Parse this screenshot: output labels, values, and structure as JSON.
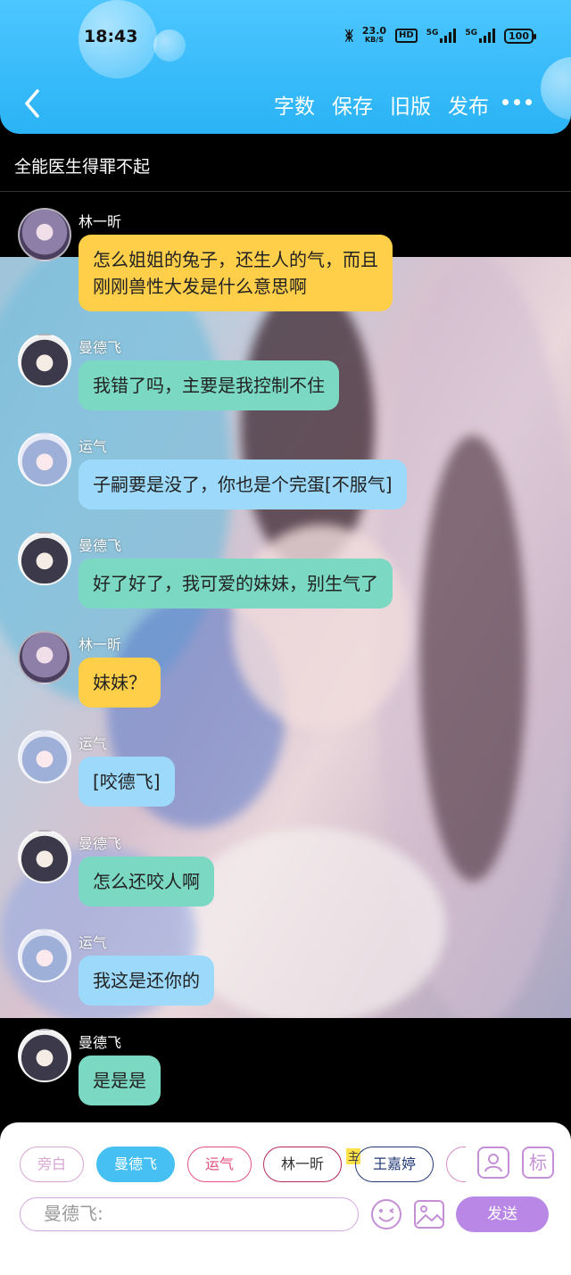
{
  "status_bar": {
    "time": "18:43",
    "speed_value": "23.0",
    "speed_unit": "KB/S",
    "hd": "HD",
    "network_1": "5G",
    "network_2": "5G",
    "battery": "100"
  },
  "header": {
    "back_icon": "chevron-left-icon",
    "actions": [
      "字数",
      "保存",
      "旧版",
      "发布"
    ],
    "more_icon": "more-dots-icon",
    "color": "#35b8f6"
  },
  "document": {
    "title": "全能医生得罪不起"
  },
  "messages": [
    {
      "speaker": "林一昕",
      "text_lines": [
        "怎么姐姐的兔子，还生人的气，而且",
        "刚刚兽性大发是什么意思啊"
      ],
      "color": "#ffcf4a"
    },
    {
      "speaker": "曼德飞",
      "text_lines": [
        "我错了吗，主要是我控制不住"
      ],
      "color": "#7bd8c2"
    },
    {
      "speaker": "运气",
      "text_lines": [
        "子嗣要是没了，你也是个完蛋[不服气]"
      ],
      "color": "#9cd9fb"
    },
    {
      "speaker": "曼德飞",
      "text_lines": [
        "好了好了，我可爱的妹妹，别生气了"
      ],
      "color": "#7bd8c2"
    },
    {
      "speaker": "林一昕",
      "text_lines": [
        "妹妹？"
      ],
      "color": "#ffcf4a"
    },
    {
      "speaker": "运气",
      "text_lines": [
        "[咬德飞]"
      ],
      "color": "#9cd9fb"
    },
    {
      "speaker": "曼德飞",
      "text_lines": [
        "怎么还咬人啊"
      ],
      "color": "#7bd8c2"
    },
    {
      "speaker": "运气",
      "text_lines": [
        "我这是还你的"
      ],
      "color": "#9cd9fb"
    },
    {
      "speaker": "曼德飞",
      "text_lines": [
        "是是是"
      ],
      "color": "#7bd8c2"
    }
  ],
  "composer": {
    "characters": [
      "旁白",
      "曼德飞",
      "运气",
      "林一昕",
      "王嘉婷"
    ],
    "selected_character": "曼德飞",
    "main_badge": "主",
    "tool_icons": [
      "character-card-icon",
      "tag-icon"
    ],
    "tag_label": "标",
    "input_value": "曼德飞:",
    "emoji_icon": "emoji-icon",
    "image_icon": "image-icon",
    "send_label": "发送",
    "send_color": "#b987e6"
  }
}
